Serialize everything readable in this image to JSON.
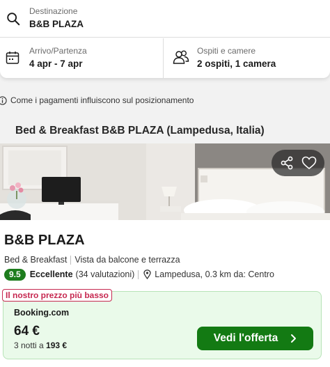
{
  "search": {
    "destination_label": "Destinazione",
    "destination_value": "B&B PLAZA",
    "dates_label": "Arrivo/Partenza",
    "dates_value": "4 apr - 7 apr",
    "guests_label": "Ospiti e camere",
    "guests_value": "2 ospiti, 1 camera"
  },
  "info_line": "Come i pagamenti influiscono sul posizionamento",
  "hotel_heading": "Bed & Breakfast B&B PLAZA (Lampedusa, Italia)",
  "hotel": {
    "name": "B&B PLAZA",
    "type": "Bed & Breakfast",
    "feature": "Vista da balcone e terrazza",
    "score": "9.5",
    "rating_word": "Eccellente",
    "reviews": "(34 valutazioni)",
    "location": "Lampedusa, 0.3 km da: Centro"
  },
  "deal": {
    "badge": "Il nostro prezzo più basso",
    "provider": "Booking.com",
    "price": "64 €",
    "nights_text": "3 notti a",
    "total": "193 €",
    "cta": "Vedi l'offerta"
  },
  "icons": {
    "search": "search-icon",
    "calendar": "calendar-icon",
    "guests": "guests-icon",
    "info": "info-icon",
    "share": "share-icon",
    "favorite": "heart-icon",
    "location": "location-pin-icon",
    "chevron": "chevron-right-icon"
  },
  "colors": {
    "rating_badge": "#1e7d1e",
    "cta_button": "#137a13",
    "deal_background": "#eafaea",
    "lowest_badge": "#c62850"
  }
}
